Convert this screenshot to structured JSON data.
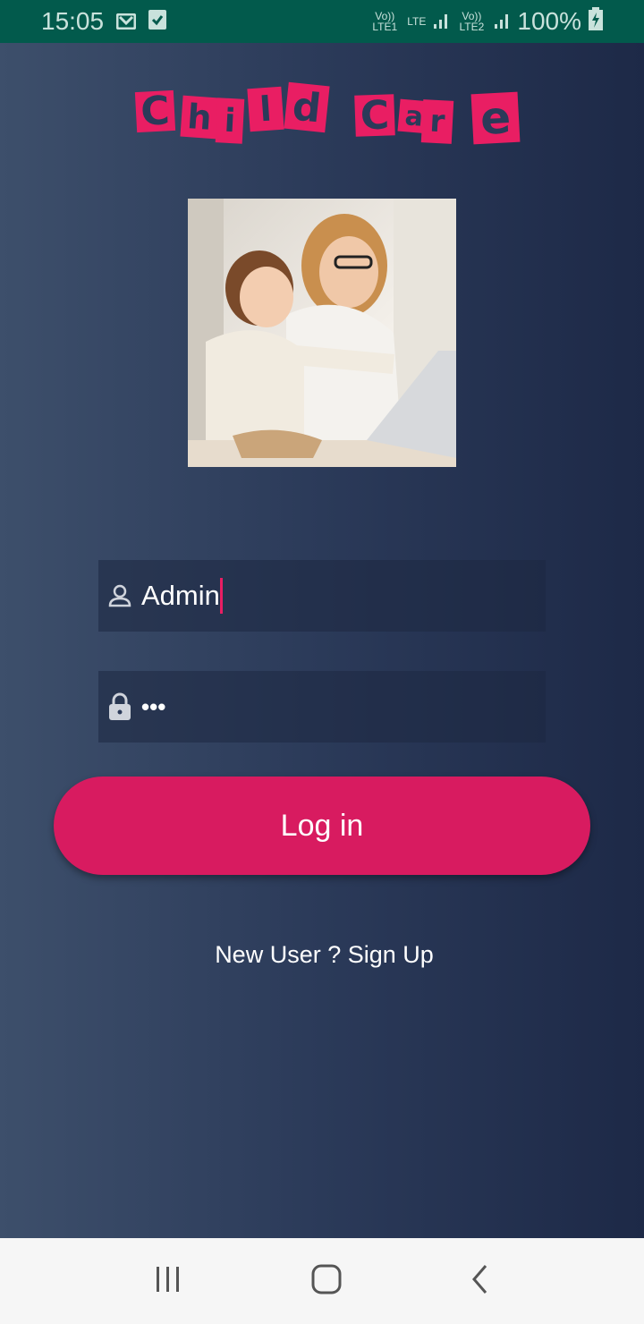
{
  "status_bar": {
    "time": "15:05",
    "battery": "100%",
    "sim1": "Vo)) LTE1",
    "sim1_net": "LTE",
    "sim2": "Vo)) LTE2",
    "icons": [
      "gmail-icon",
      "checkbox-icon",
      "signal-icon",
      "battery-charging-icon"
    ]
  },
  "logo": {
    "text": "Child Care"
  },
  "colors": {
    "accent": "#d81b60",
    "status_bar": "#025a4c"
  },
  "form": {
    "username_value": "Admin",
    "password_value": "•••",
    "login_label": "Log in",
    "signup_label": "New User ? Sign Up"
  },
  "nav": {
    "icons": [
      "recents-icon",
      "home-icon",
      "back-icon"
    ]
  }
}
